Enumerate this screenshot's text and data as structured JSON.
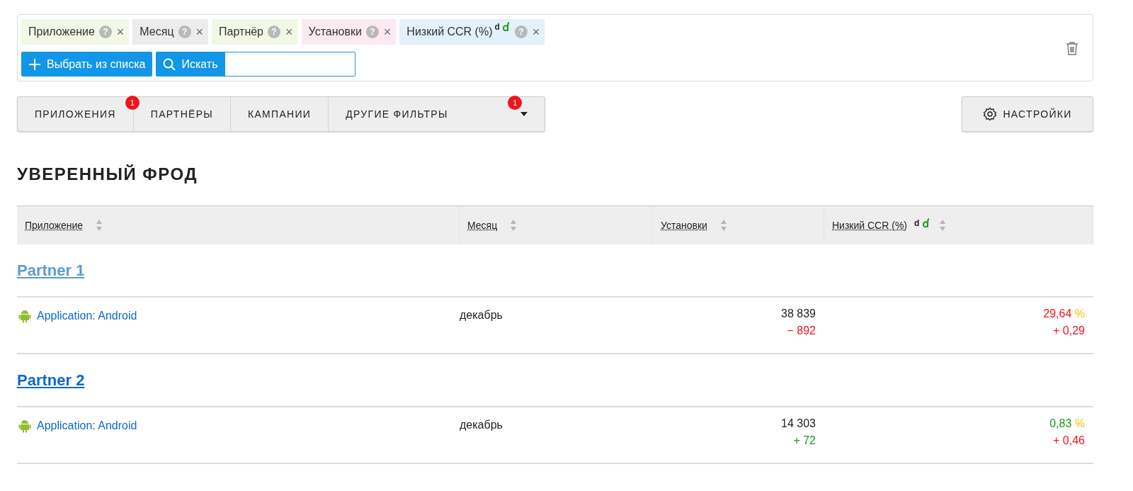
{
  "filters": {
    "chips": [
      {
        "label": "Приложение",
        "help": "?",
        "remove": "×",
        "color": "#f1f8e6"
      },
      {
        "label": "Месяц",
        "help": "?",
        "remove": "×",
        "color": "#ececec"
      },
      {
        "label": "Партнёр",
        "help": "?",
        "remove": "×",
        "color": "#f1f8e6"
      },
      {
        "label": "Установки",
        "help": "?",
        "remove": "×",
        "color": "#fde9f1"
      },
      {
        "label": "Низкий CCR (%)",
        "help": "?",
        "remove": "×",
        "color": "#e3f1fc",
        "suffix": "d",
        "marked": true
      }
    ],
    "add_button": "Выбрать из списка",
    "search_button": "Искать"
  },
  "tabs": [
    {
      "label": "ПРИЛОЖЕНИЯ",
      "badge": "1"
    },
    {
      "label": "ПАРТНЁРЫ"
    },
    {
      "label": "КАМПАНИИ"
    },
    {
      "label": "ДРУГИЕ ФИЛЬТРЫ",
      "badge": "1",
      "dropdown": true
    }
  ],
  "settings_button": "НАСТРОЙКИ",
  "section_title": "УВЕРЕННЫЙ ФРОД",
  "table": {
    "columns": [
      {
        "label": "Приложение"
      },
      {
        "label": "Месяц"
      },
      {
        "label": "Установки"
      },
      {
        "label": "Низкий CCR (%)",
        "suffix": "d",
        "marked": true
      }
    ],
    "groups": [
      {
        "partner": "Partner 1",
        "visited": true,
        "rows": [
          {
            "app": "Application: Android",
            "month": "декабрь",
            "installs": "38 839",
            "installs_delta": {
              "text": "− 892",
              "color": "#f0141e"
            },
            "ccr": {
              "text": "29,64",
              "color": "#f0141e"
            },
            "ccr_unit": "%",
            "ccr_delta": {
              "text": "+ 0,29",
              "color": "#f0141e"
            }
          }
        ]
      },
      {
        "partner": "Partner 2",
        "visited": false,
        "rows": [
          {
            "app": "Application: Android",
            "month": "декабрь",
            "installs": "14 303",
            "installs_delta": {
              "text": "+ 72",
              "color": "#1e9614"
            },
            "ccr": {
              "text": "0,83",
              "color": "#1e9614"
            },
            "ccr_unit": "%",
            "ccr_delta": {
              "text": "+ 0,46",
              "color": "#f0141e"
            }
          }
        ]
      }
    ]
  }
}
